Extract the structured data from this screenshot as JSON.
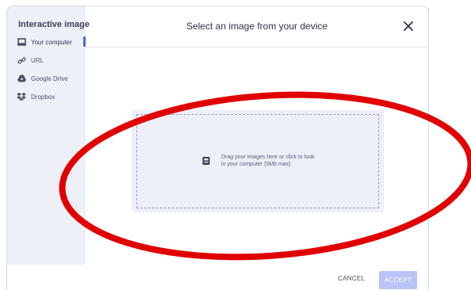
{
  "sidebar": {
    "title": "Interactive image",
    "items": [
      {
        "label": "Your computer",
        "icon": "laptop-icon",
        "active": true
      },
      {
        "label": "URL",
        "icon": "link-icon"
      },
      {
        "label": "Google Drive",
        "icon": "google-drive-icon"
      },
      {
        "label": "Dropbox",
        "icon": "dropbox-icon"
      }
    ]
  },
  "header": {
    "title": "Select an image from your device",
    "close_icon": "close-icon"
  },
  "dropzone": {
    "icon": "upload-image-icon",
    "line1": "Drag your images here or click to look",
    "line2": "in your computer (5Mb max)"
  },
  "footer": {
    "cancel_label": "CANCEL",
    "accept_label": "ACCEPT"
  },
  "colors": {
    "accent": "#4b63e6",
    "sidebar_bg": "#eef0f8",
    "accept_disabled": "#b9c3f5",
    "annotation": "#e10000"
  }
}
